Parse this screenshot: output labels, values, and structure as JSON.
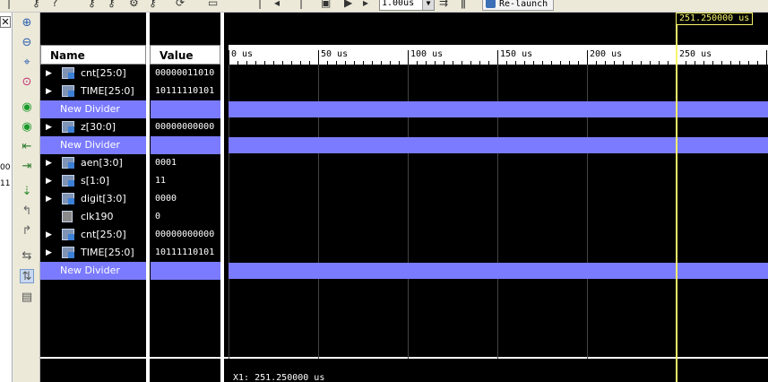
{
  "toolbar": {
    "icons": [
      "key-icon",
      "help-cursor-icon",
      "key-icon",
      "key-icon",
      "network-icon",
      "key-icon",
      "refresh-icon",
      "screen-icon",
      "play-icon",
      "play-step-icon",
      "run-for-icon",
      "restart-icon",
      "pause-icon"
    ],
    "run_time": "1.00us",
    "relaunch_label": "Re-launch"
  },
  "left_strip": {
    "close_symbol": "✕",
    "fragments": [
      "00",
      "11"
    ]
  },
  "vertical_toolbar": {
    "icons": [
      "zoom-in-icon",
      "zoom-out-icon",
      "zoom-fit-icon",
      "zoom-to-cursor-icon",
      "go-to-start-icon",
      "go-to-end-icon",
      "previous-transition-icon",
      "next-transition-icon",
      "add-marker-icon",
      "previous-marker-icon",
      "next-marker-icon",
      "swap-cursors-icon",
      "snap-to-transition-icon",
      "floating-ruler-icon"
    ]
  },
  "wave": {
    "name_header": "Name",
    "value_header": "Value",
    "rows": [
      {
        "name": "cnt[25:0]",
        "value": "00000011010",
        "kind": "bus",
        "expandable": true
      },
      {
        "name": "TIME[25:0]",
        "value": "10111110101",
        "kind": "bus",
        "expandable": true
      },
      {
        "name": "New Divider",
        "value": "",
        "kind": "divider",
        "expandable": false
      },
      {
        "name": "z[30:0]",
        "value": "00000000000",
        "kind": "bus",
        "expandable": true
      },
      {
        "name": "New Divider",
        "value": "",
        "kind": "divider",
        "expandable": false
      },
      {
        "name": "aen[3:0]",
        "value": "0001",
        "kind": "bus",
        "expandable": true
      },
      {
        "name": "s[1:0]",
        "value": "11",
        "kind": "bus",
        "expandable": true
      },
      {
        "name": "digit[3:0]",
        "value": "0000",
        "kind": "bus",
        "expandable": true
      },
      {
        "name": "clk190",
        "value": "0",
        "kind": "bit",
        "expandable": false
      },
      {
        "name": "cnt[25:0]",
        "value": "00000000000",
        "kind": "bus",
        "expandable": true
      },
      {
        "name": "TIME[25:0]",
        "value": "10111110101",
        "kind": "bus",
        "expandable": true
      },
      {
        "name": "New Divider",
        "value": "",
        "kind": "divider",
        "expandable": false
      }
    ],
    "time_labels": [
      "0 us",
      "50 us",
      "100 us",
      "150 us",
      "200 us",
      "250 us"
    ],
    "cursor_time": "251.250000 us",
    "x_readout": "X1: 251.250000 us",
    "colors": {
      "background": "#000000",
      "divider": "#7b7bff",
      "cursor": "#f5f56b"
    }
  }
}
